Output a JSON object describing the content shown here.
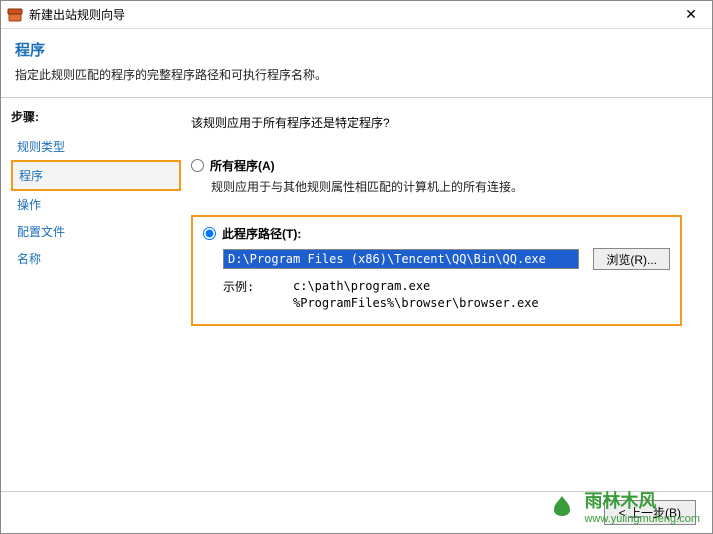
{
  "titlebar": {
    "title": "新建出站规则向导",
    "close": "✕"
  },
  "header": {
    "title": "程序",
    "desc": "指定此规则匹配的程序的完整程序路径和可执行程序名称。"
  },
  "sidebar": {
    "label": "步骤:",
    "items": [
      {
        "label": "规则类型",
        "active": false
      },
      {
        "label": "程序",
        "active": true
      },
      {
        "label": "操作",
        "active": false
      },
      {
        "label": "配置文件",
        "active": false
      },
      {
        "label": "名称",
        "active": false
      }
    ]
  },
  "content": {
    "question": "该规则应用于所有程序还是特定程序?",
    "option_all": {
      "label": "所有程序(A)",
      "desc": "规则应用于与其他规则属性相匹配的计算机上的所有连接。"
    },
    "option_path": {
      "label": "此程序路径(T):",
      "value": "D:\\Program Files (x86)\\Tencent\\QQ\\Bin\\QQ.exe",
      "browse": "浏览(R)...",
      "example_label": "示例:",
      "example1": "c:\\path\\program.exe",
      "example2": "%ProgramFiles%\\browser\\browser.exe"
    }
  },
  "footer": {
    "back": "< 上一步(B)"
  },
  "watermark": {
    "text": "雨林木风",
    "url": "www.yulingmufeng.com"
  }
}
